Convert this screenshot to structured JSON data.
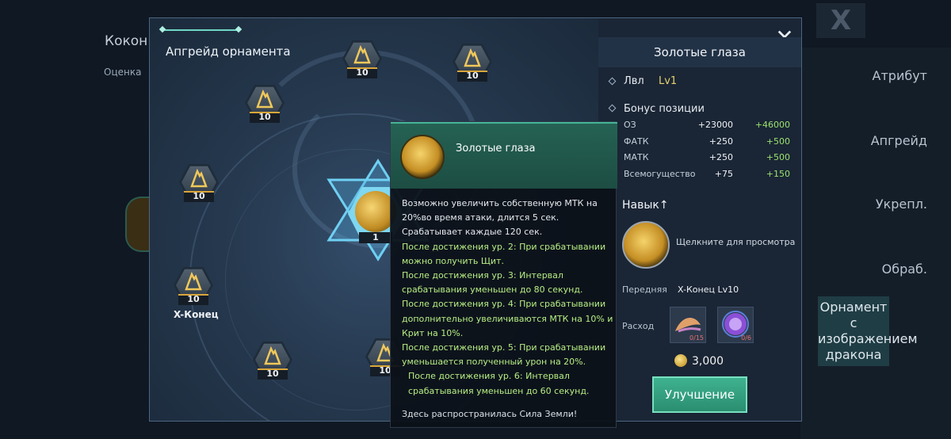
{
  "background": {
    "title": "Кокон д",
    "sub_label": "Оценка",
    "close_label": "X",
    "menu": [
      {
        "label": "Атрибут",
        "active": false
      },
      {
        "label": "Апгрейд",
        "active": false
      },
      {
        "label": "Укрепл.",
        "active": false
      },
      {
        "label": "Обраб.",
        "active": false
      },
      {
        "label": "Орнамент с изображением дракона",
        "active": true
      }
    ]
  },
  "tree": {
    "title": "Апгрейд орнамента",
    "nodes": [
      {
        "level": "10"
      },
      {
        "level": "10"
      },
      {
        "level": "10"
      },
      {
        "level": "10"
      },
      {
        "level": "10"
      },
      {
        "level": "10"
      },
      {
        "level": "10"
      }
    ],
    "center_level": "1",
    "end_node_name": "X-Конец"
  },
  "info": {
    "title": "Золотые глаза",
    "close_label": "✕",
    "lvl_label": "Лвл",
    "lvl_value": "Lv1",
    "bonus_label": "Бонус позиции",
    "stats": [
      {
        "name": "ОЗ",
        "base": "+23000",
        "max": "+46000"
      },
      {
        "name": "ФАТК",
        "base": "+250",
        "max": "+500"
      },
      {
        "name": "МАТК",
        "base": "+250",
        "max": "+500"
      },
      {
        "name": "Всемогущество",
        "base": "+75",
        "max": "+150"
      }
    ],
    "skill_label": "Навык↑",
    "skill_hint": "Щелкните для просмотра",
    "prev_label": "Передняя",
    "prev_value": "X-Конец Lv10",
    "cost_label": "Расход",
    "cost_items": [
      {
        "icon": "feather-material-icon",
        "need": "0/15"
      },
      {
        "icon": "purple-orb-icon",
        "need": "0/6"
      }
    ],
    "gold": "3,000",
    "upgrade_label": "Улучшение"
  },
  "tooltip": {
    "title": "Золотые глаза",
    "base_text": "Возможно увеличить собственную МТК на 20%во время атаки, длится 5 сек. Срабатывает каждые 120 сек.",
    "bonuses": [
      "После достижения ур. 2: При срабатывании можно получить Щит.",
      "После достижения ур. 3: Интервал срабатывания уменьшен до 80 секунд.",
      "После достижения ур. 4: При срабатывании дополнительно увеличиваются МТК на 10% и Крит на 10%.",
      "После достижения ур. 5: При срабатывании уменьшается полученный урон на 20%.",
      "После достижения ур. 6: Интервал срабатывания уменьшен до 60 секунд."
    ],
    "flavor": "Здесь распространилась Сила Земли!"
  }
}
